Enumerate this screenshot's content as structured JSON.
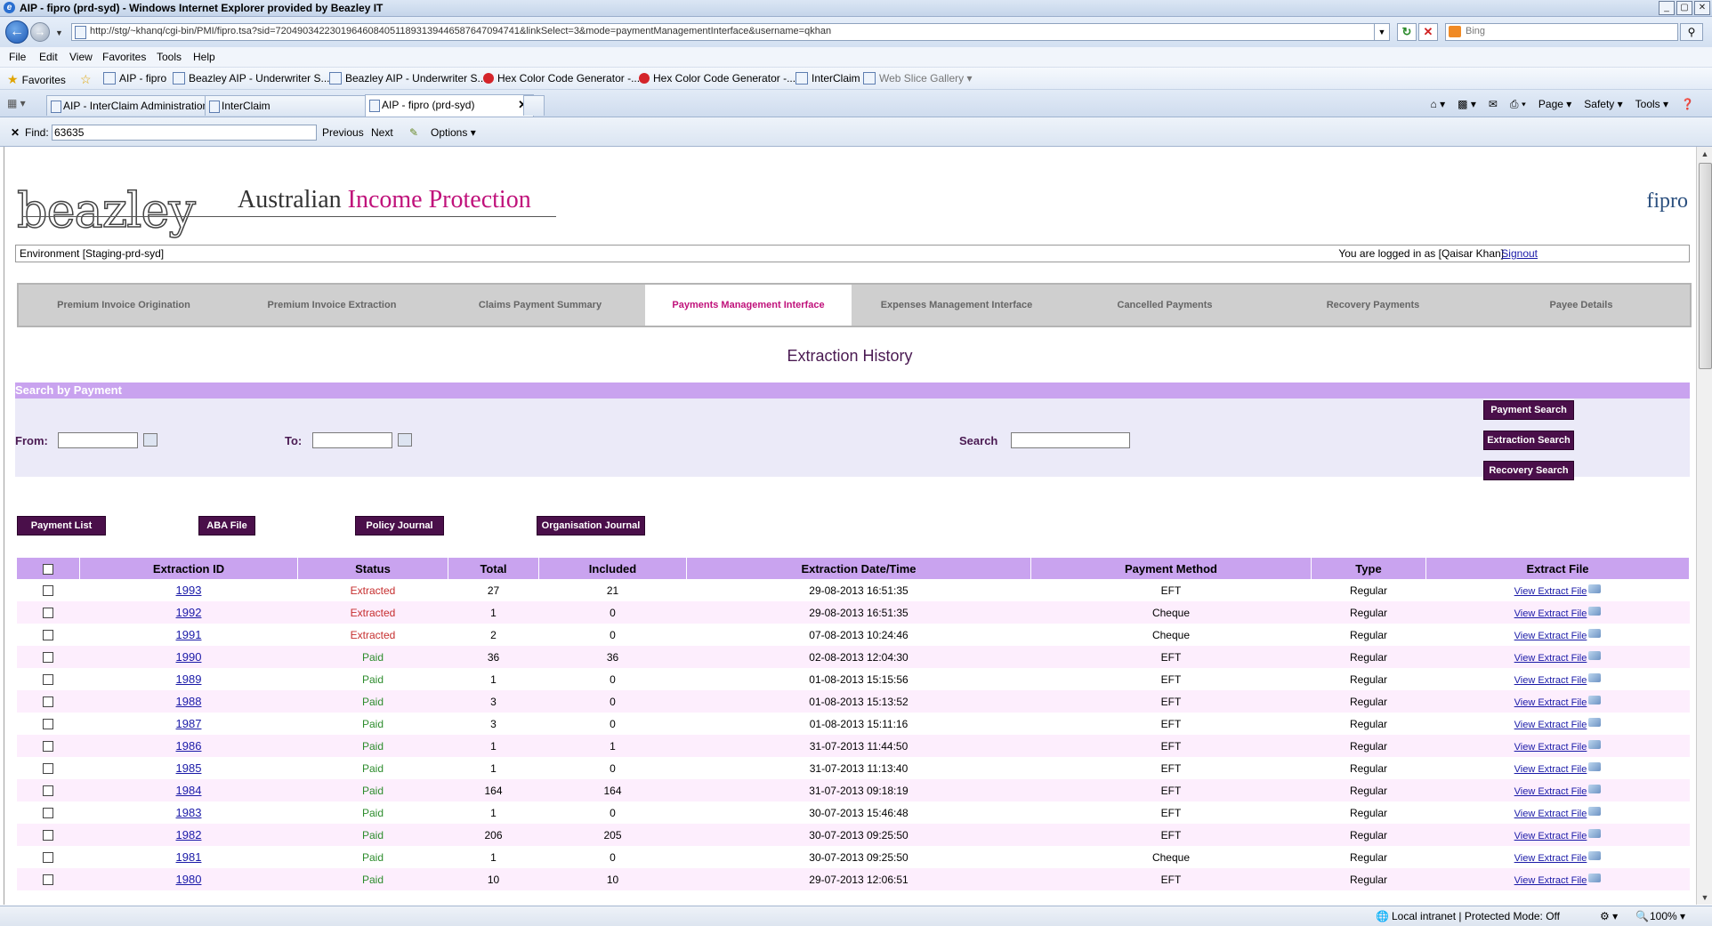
{
  "window": {
    "title": "AIP - fipro (prd-syd) - Windows Internet Explorer provided by Beazley IT",
    "buttons": [
      "_",
      "▢",
      "✕"
    ]
  },
  "address": {
    "url": "http://stg/~khanq/cgi-bin/PMI/fipro.tsa?sid=72049034223019646084051189313944658764709474​1&linkSelect=3&mode=paymentManagementInterface&username=qkhan",
    "search_placeholder": "Bing"
  },
  "menu": [
    "File",
    "Edit",
    "View",
    "Favorites",
    "Tools",
    "Help"
  ],
  "favorites": {
    "label": "Favorites",
    "items": [
      "AIP - fipro",
      "Beazley AIP - Underwriter S...",
      "Beazley AIP - Underwriter S...",
      "Hex Color Code Generator -...",
      "Hex Color Code Generator -...",
      "InterClaim",
      "Web Slice Gallery ▾"
    ]
  },
  "tabs": [
    {
      "label": "AIP - InterClaim Administration"
    },
    {
      "label": "InterClaim"
    },
    {
      "label": "AIP - fipro (prd-syd)",
      "active": true
    }
  ],
  "commands": [
    "Page ▾",
    "Safety ▾",
    "Tools ▾"
  ],
  "find": {
    "label": "Find:",
    "value": "63635",
    "previous": "Previous",
    "next": "Next",
    "options": "Options ▾"
  },
  "header": {
    "logo": "beazley",
    "title_plain": "Australian ",
    "title_accent": "Income Protection",
    "app_name": "fipro"
  },
  "environment": {
    "label": "Environment [Staging-prd-syd]",
    "login_text": "You are logged in as [Qaisar Khan]",
    "signout": "Signout"
  },
  "nav_tabs": [
    "Premium Invoice Origination",
    "Premium Invoice Extraction",
    "Claims Payment Summary",
    "Payments Management Interface",
    "Expenses Management Interface",
    "Cancelled Payments",
    "Recovery Payments",
    "Payee Details"
  ],
  "nav_active_index": 3,
  "heading": "Extraction History",
  "search_panel": {
    "title": "Search by Payment",
    "from_label": "From:",
    "to_label": "To:",
    "search_label": "Search",
    "buttons": [
      "Payment Search",
      "Extraction Search",
      "Recovery Search"
    ]
  },
  "actions": [
    "Payment List",
    "ABA File",
    "Policy Journal",
    "Organisation Journal"
  ],
  "table": {
    "columns": [
      "",
      "Extraction ID",
      "Status",
      "Total",
      "Included",
      "Extraction Date/Time",
      "Payment Method",
      "Type",
      "Extract File"
    ],
    "view_link": "View Extract File",
    "rows": [
      [
        "1993",
        "Extracted",
        "27",
        "21",
        "29-08-2013 16:51:35",
        "EFT",
        "Regular"
      ],
      [
        "1992",
        "Extracted",
        "1",
        "0",
        "29-08-2013 16:51:35",
        "Cheque",
        "Regular"
      ],
      [
        "1991",
        "Extracted",
        "2",
        "0",
        "07-08-2013 10:24:46",
        "Cheque",
        "Regular"
      ],
      [
        "1990",
        "Paid",
        "36",
        "36",
        "02-08-2013 12:04:30",
        "EFT",
        "Regular"
      ],
      [
        "1989",
        "Paid",
        "1",
        "0",
        "01-08-2013 15:15:56",
        "EFT",
        "Regular"
      ],
      [
        "1988",
        "Paid",
        "3",
        "0",
        "01-08-2013 15:13:52",
        "EFT",
        "Regular"
      ],
      [
        "1987",
        "Paid",
        "3",
        "0",
        "01-08-2013 15:11:16",
        "EFT",
        "Regular"
      ],
      [
        "1986",
        "Paid",
        "1",
        "1",
        "31-07-2013 11:44:50",
        "EFT",
        "Regular"
      ],
      [
        "1985",
        "Paid",
        "1",
        "0",
        "31-07-2013 11:13:40",
        "EFT",
        "Regular"
      ],
      [
        "1984",
        "Paid",
        "164",
        "164",
        "31-07-2013 09:18:19",
        "EFT",
        "Regular"
      ],
      [
        "1983",
        "Paid",
        "1",
        "0",
        "30-07-2013 15:46:48",
        "EFT",
        "Regular"
      ],
      [
        "1982",
        "Paid",
        "206",
        "205",
        "30-07-2013 09:25:50",
        "EFT",
        "Regular"
      ],
      [
        "1981",
        "Paid",
        "1",
        "0",
        "30-07-2013 09:25:50",
        "Cheque",
        "Regular"
      ],
      [
        "1980",
        "Paid",
        "10",
        "10",
        "29-07-2013 12:06:51",
        "EFT",
        "Regular"
      ]
    ]
  },
  "status_bar": {
    "zone": "Local intranet | Protected Mode: Off",
    "zoom": "100%"
  },
  "colors": {
    "accent": "#c0127b",
    "header_purple": "#c9a3ef",
    "button_purple": "#4a0f4a",
    "extracted": "#c62e2e",
    "paid": "#2c8c2c"
  }
}
